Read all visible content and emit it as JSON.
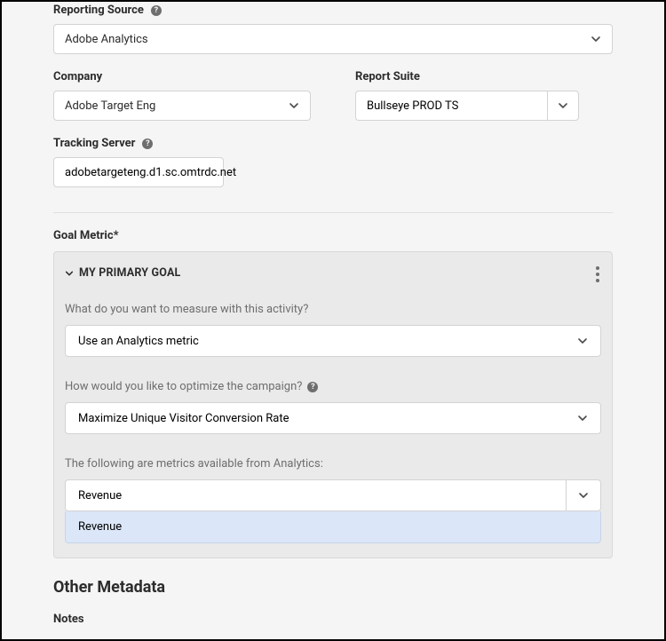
{
  "labels": {
    "reporting_source": "Reporting Source",
    "company": "Company",
    "report_suite": "Report Suite",
    "tracking_server": "Tracking Server",
    "goal_metric": "Goal Metric*",
    "notes": "Notes"
  },
  "values": {
    "reporting_source": "Adobe Analytics",
    "company": "Adobe Target Eng",
    "report_suite": "Bullseye PROD TS",
    "tracking_server": "adobetargeteng.d1.sc.omtrdc.net"
  },
  "goal": {
    "header": "MY PRIMARY GOAL",
    "q_measure": "What do you want to measure with this activity?",
    "measure_value": "Use an Analytics metric",
    "q_optimize": "How would you like to optimize the campaign?",
    "optimize_value": "Maximize Unique Visitor Conversion Rate",
    "available_label": "The following are metrics available from Analytics:",
    "metric_value": "Revenue",
    "dropdown_option": "Revenue"
  },
  "other_metadata_heading": "Other Metadata"
}
